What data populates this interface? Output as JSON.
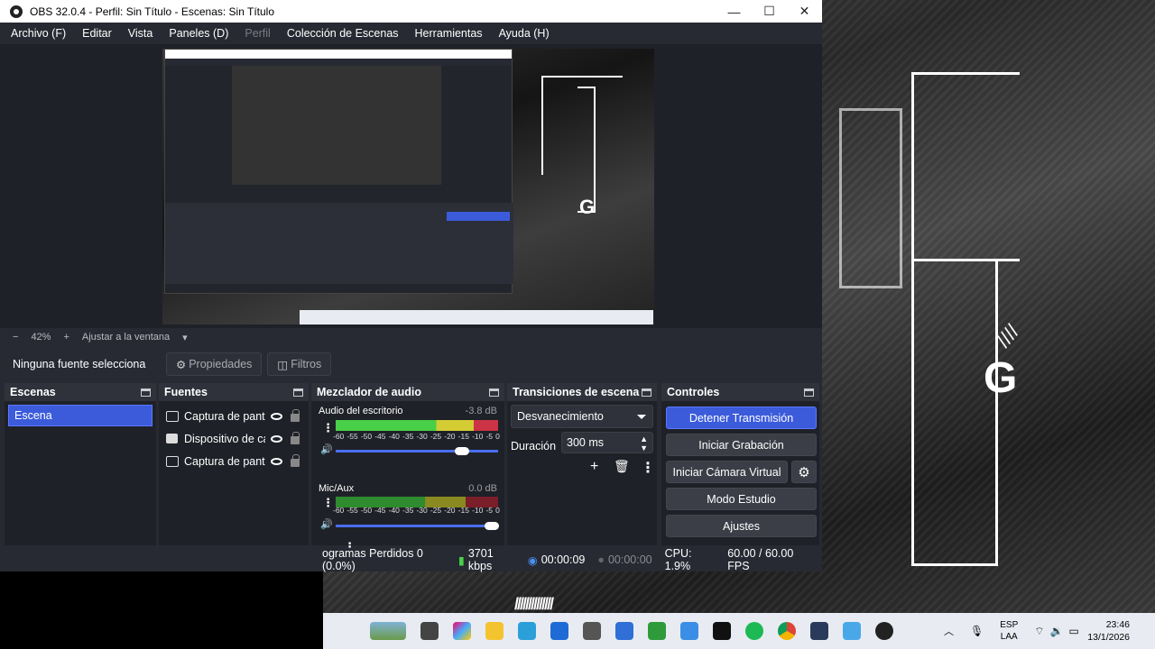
{
  "window": {
    "title": "OBS 32.0.4 - Perfil: Sin Título - Escenas: Sin Título"
  },
  "menu": [
    "Archivo (F)",
    "Editar",
    "Vista",
    "Paneles (D)",
    "Perfil",
    "Colección de Escenas",
    "Herramientas",
    "Ayuda (H)"
  ],
  "zoom": {
    "minus": "−",
    "value": "42%",
    "plus": "+",
    "fit": "Ajustar a la ventana"
  },
  "source_bar": {
    "none_selected": "Ninguna fuente selecciona",
    "properties": "Propiedades",
    "filters": "Filtros"
  },
  "docks": {
    "scenes": {
      "title": "Escenas",
      "items": [
        "Escena"
      ]
    },
    "sources": {
      "title": "Fuentes",
      "items": [
        {
          "name": "Captura de pantalla",
          "icon": "monitor-icon"
        },
        {
          "name": "Dispositivo de captura",
          "icon": "camera-icon"
        },
        {
          "name": "Captura de pantalla",
          "icon": "monitor-icon"
        }
      ]
    },
    "mixer": {
      "title": "Mezclador de audio",
      "channels": [
        {
          "name": "Audio del escritorio",
          "db": "-3.8 dB",
          "volume": 0.78
        },
        {
          "name": "Mic/Aux",
          "db": "0.0 dB",
          "volume": 0.96
        }
      ],
      "ticks": [
        "-60",
        "-55",
        "-50",
        "-45",
        "-40",
        "-35",
        "-30",
        "-25",
        "-20",
        "-15",
        "-10",
        "-5",
        "0"
      ]
    },
    "transitions": {
      "title": "Transiciones de escena",
      "selected": "Desvanecimiento",
      "duration_label": "Duración",
      "duration_value": "300 ms"
    },
    "controls": {
      "title": "Controles",
      "stop_stream": "Detener Transmisión",
      "start_recording": "Iniciar Grabación",
      "start_virtual_cam": "Iniciar Cámara Virtual",
      "studio_mode": "Modo Estudio",
      "settings": "Ajustes"
    }
  },
  "status": {
    "dropped_frames": "ogramas Perdidos 0 (0.0%)",
    "bitrate": "3701 kbps",
    "stream_time": "00:00:09",
    "record_time": "00:00:00",
    "cpu": "CPU: 1.9%",
    "fps": "60.00 / 60.00 FPS"
  },
  "taskbar": {
    "lang_top": "ESP",
    "lang_bottom": "LAA",
    "time": "23:46",
    "date": "13/1/2026"
  },
  "colors": {
    "accent": "#3b5bdb",
    "panel": "#272a33",
    "panel_dark": "#1f2128"
  }
}
